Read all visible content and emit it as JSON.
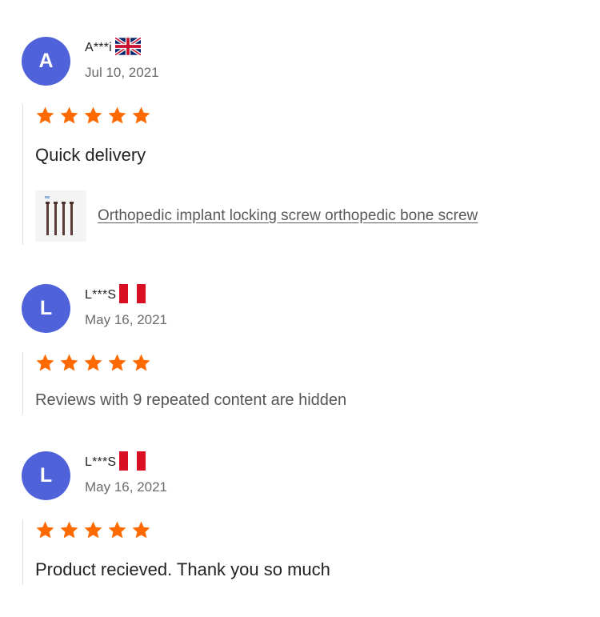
{
  "reviews": [
    {
      "avatar_letter": "A",
      "user": "A***i",
      "country_flag_icon": "uk-flag-icon",
      "date": "Jul 10, 2021",
      "rating": 5,
      "text": "Quick delivery",
      "product_link": "Orthopedic implant locking screw orthopedic bone screw"
    },
    {
      "avatar_letter": "L",
      "user": "L***S",
      "country_flag_icon": "peru-flag-icon",
      "date": "May 16, 2021",
      "rating": 5,
      "text": "Reviews with 9 repeated content are hidden"
    },
    {
      "avatar_letter": "L",
      "user": "L***S",
      "country_flag_icon": "peru-flag-icon",
      "date": "May 16, 2021",
      "rating": 5,
      "text": "Product recieved. Thank you so much"
    }
  ],
  "colors": {
    "avatar": "#4f62d9",
    "star": "#ff6a00",
    "divider": "#dddddd"
  }
}
